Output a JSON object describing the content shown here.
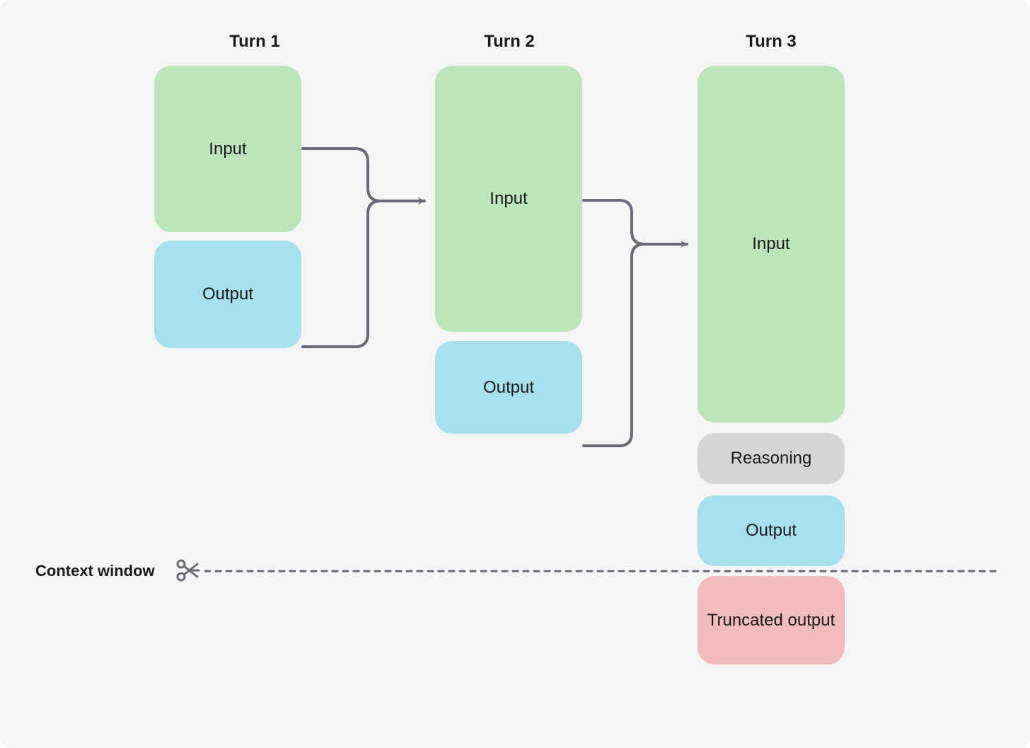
{
  "headings": {
    "turn1": "Turn 1",
    "turn2": "Turn 2",
    "turn3": "Turn 3"
  },
  "labels": {
    "input": "Input",
    "output": "Output",
    "reasoning": "Reasoning",
    "truncated": "Truncated output",
    "context_window": "Context window"
  },
  "colors": {
    "input": "#bce5bc",
    "output": "#a9e0ef",
    "reasoning": "#d5d5d5",
    "truncated": "#f3bcbc",
    "arrow": "#6b6b78",
    "background": "#f5f5f5"
  },
  "diagram": {
    "turns": [
      {
        "id": "turn1",
        "blocks": [
          {
            "type": "input",
            "relative_height": 1.0
          },
          {
            "type": "output",
            "relative_height": 0.55
          }
        ]
      },
      {
        "id": "turn2",
        "blocks": [
          {
            "type": "input",
            "relative_height": 1.6
          },
          {
            "type": "output",
            "relative_height": 0.55
          }
        ]
      },
      {
        "id": "turn3",
        "blocks": [
          {
            "type": "input",
            "relative_height": 2.14
          },
          {
            "type": "reasoning",
            "relative_height": 0.3
          },
          {
            "type": "output",
            "relative_height": 0.43
          },
          {
            "type": "truncated",
            "relative_height": 0.53,
            "below_context_limit": true
          }
        ]
      }
    ],
    "context_window_relative_y": 0.77,
    "arrows": [
      {
        "from_turn": "turn1",
        "to_turn": "turn2",
        "description": "input+output feed into next input"
      },
      {
        "from_turn": "turn2",
        "to_turn": "turn3",
        "description": "input+output feed into next input"
      }
    ]
  }
}
